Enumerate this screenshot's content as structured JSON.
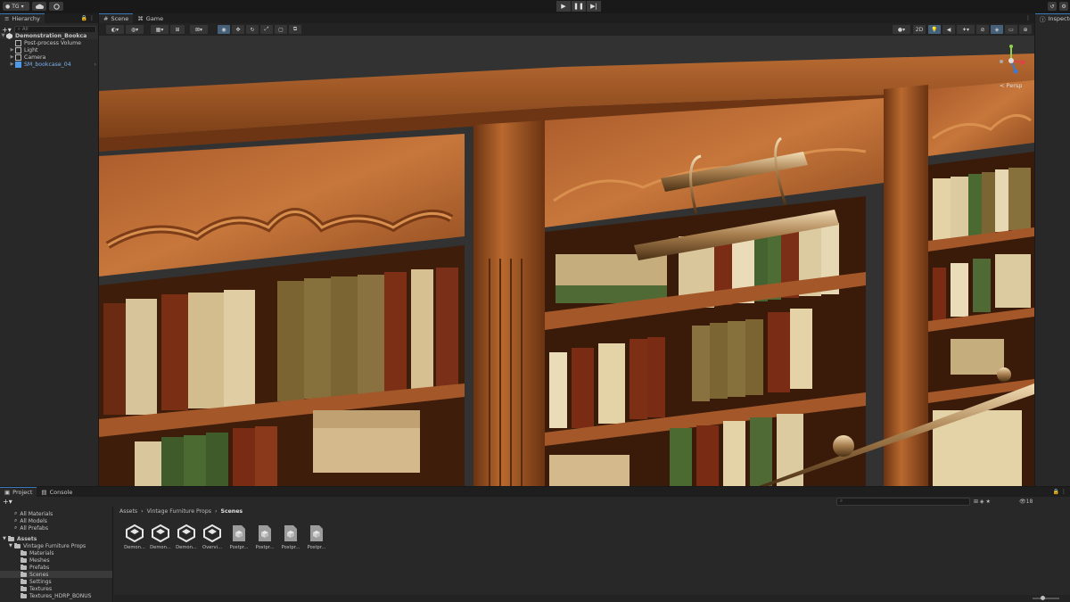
{
  "toolbar": {
    "account_label": "TG",
    "play_icon": "play-icon",
    "pause_icon": "pause-icon",
    "step_icon": "step-icon"
  },
  "hierarchy": {
    "tab_label": "Hierarchy",
    "search_placeholder": "All",
    "rows": [
      {
        "label": "Demonstration_Bookca",
        "type": "scene"
      },
      {
        "label": "Post-process Volume",
        "type": "object"
      },
      {
        "label": "Light",
        "type": "object"
      },
      {
        "label": "Camera",
        "type": "object"
      },
      {
        "label": "SM_bookcase_04",
        "type": "prefab"
      }
    ]
  },
  "scene_view": {
    "tabs": [
      {
        "label": "Scene"
      },
      {
        "label": "Game"
      }
    ],
    "mode_2d_label": "2D",
    "gizmo_label": "< Persp",
    "accent_color": "#3a79bb"
  },
  "inspector": {
    "tab_label": "Inspector"
  },
  "project": {
    "tabs": [
      {
        "label": "Project"
      },
      {
        "label": "Console"
      }
    ],
    "favorites": [
      "All Materials",
      "All Models",
      "All Prefabs"
    ],
    "assets_root": "Assets",
    "tree": [
      {
        "label": "Vintage Furniture Props",
        "selected": false
      },
      {
        "label": "Materials",
        "selected": false
      },
      {
        "label": "Meshes",
        "selected": false
      },
      {
        "label": "Prefabs",
        "selected": false
      },
      {
        "label": "Scenes",
        "selected": true
      },
      {
        "label": "Settings",
        "selected": false
      },
      {
        "label": "Textures",
        "selected": false
      },
      {
        "label": "Textures_HDRP_BONUS",
        "selected": false
      }
    ],
    "breadcrumb": [
      "Assets",
      "Vintage Furniture Props",
      "Scenes"
    ],
    "item_count": "18",
    "assets": [
      {
        "label": "Demon...",
        "kind": "scene"
      },
      {
        "label": "Demon...",
        "kind": "scene"
      },
      {
        "label": "Demon...",
        "kind": "scene"
      },
      {
        "label": "Overvi...",
        "kind": "scene"
      },
      {
        "label": "Postpr...",
        "kind": "profile"
      },
      {
        "label": "Postpr...",
        "kind": "profile"
      },
      {
        "label": "Postpr...",
        "kind": "profile"
      },
      {
        "label": "Postpr...",
        "kind": "profile"
      }
    ]
  }
}
